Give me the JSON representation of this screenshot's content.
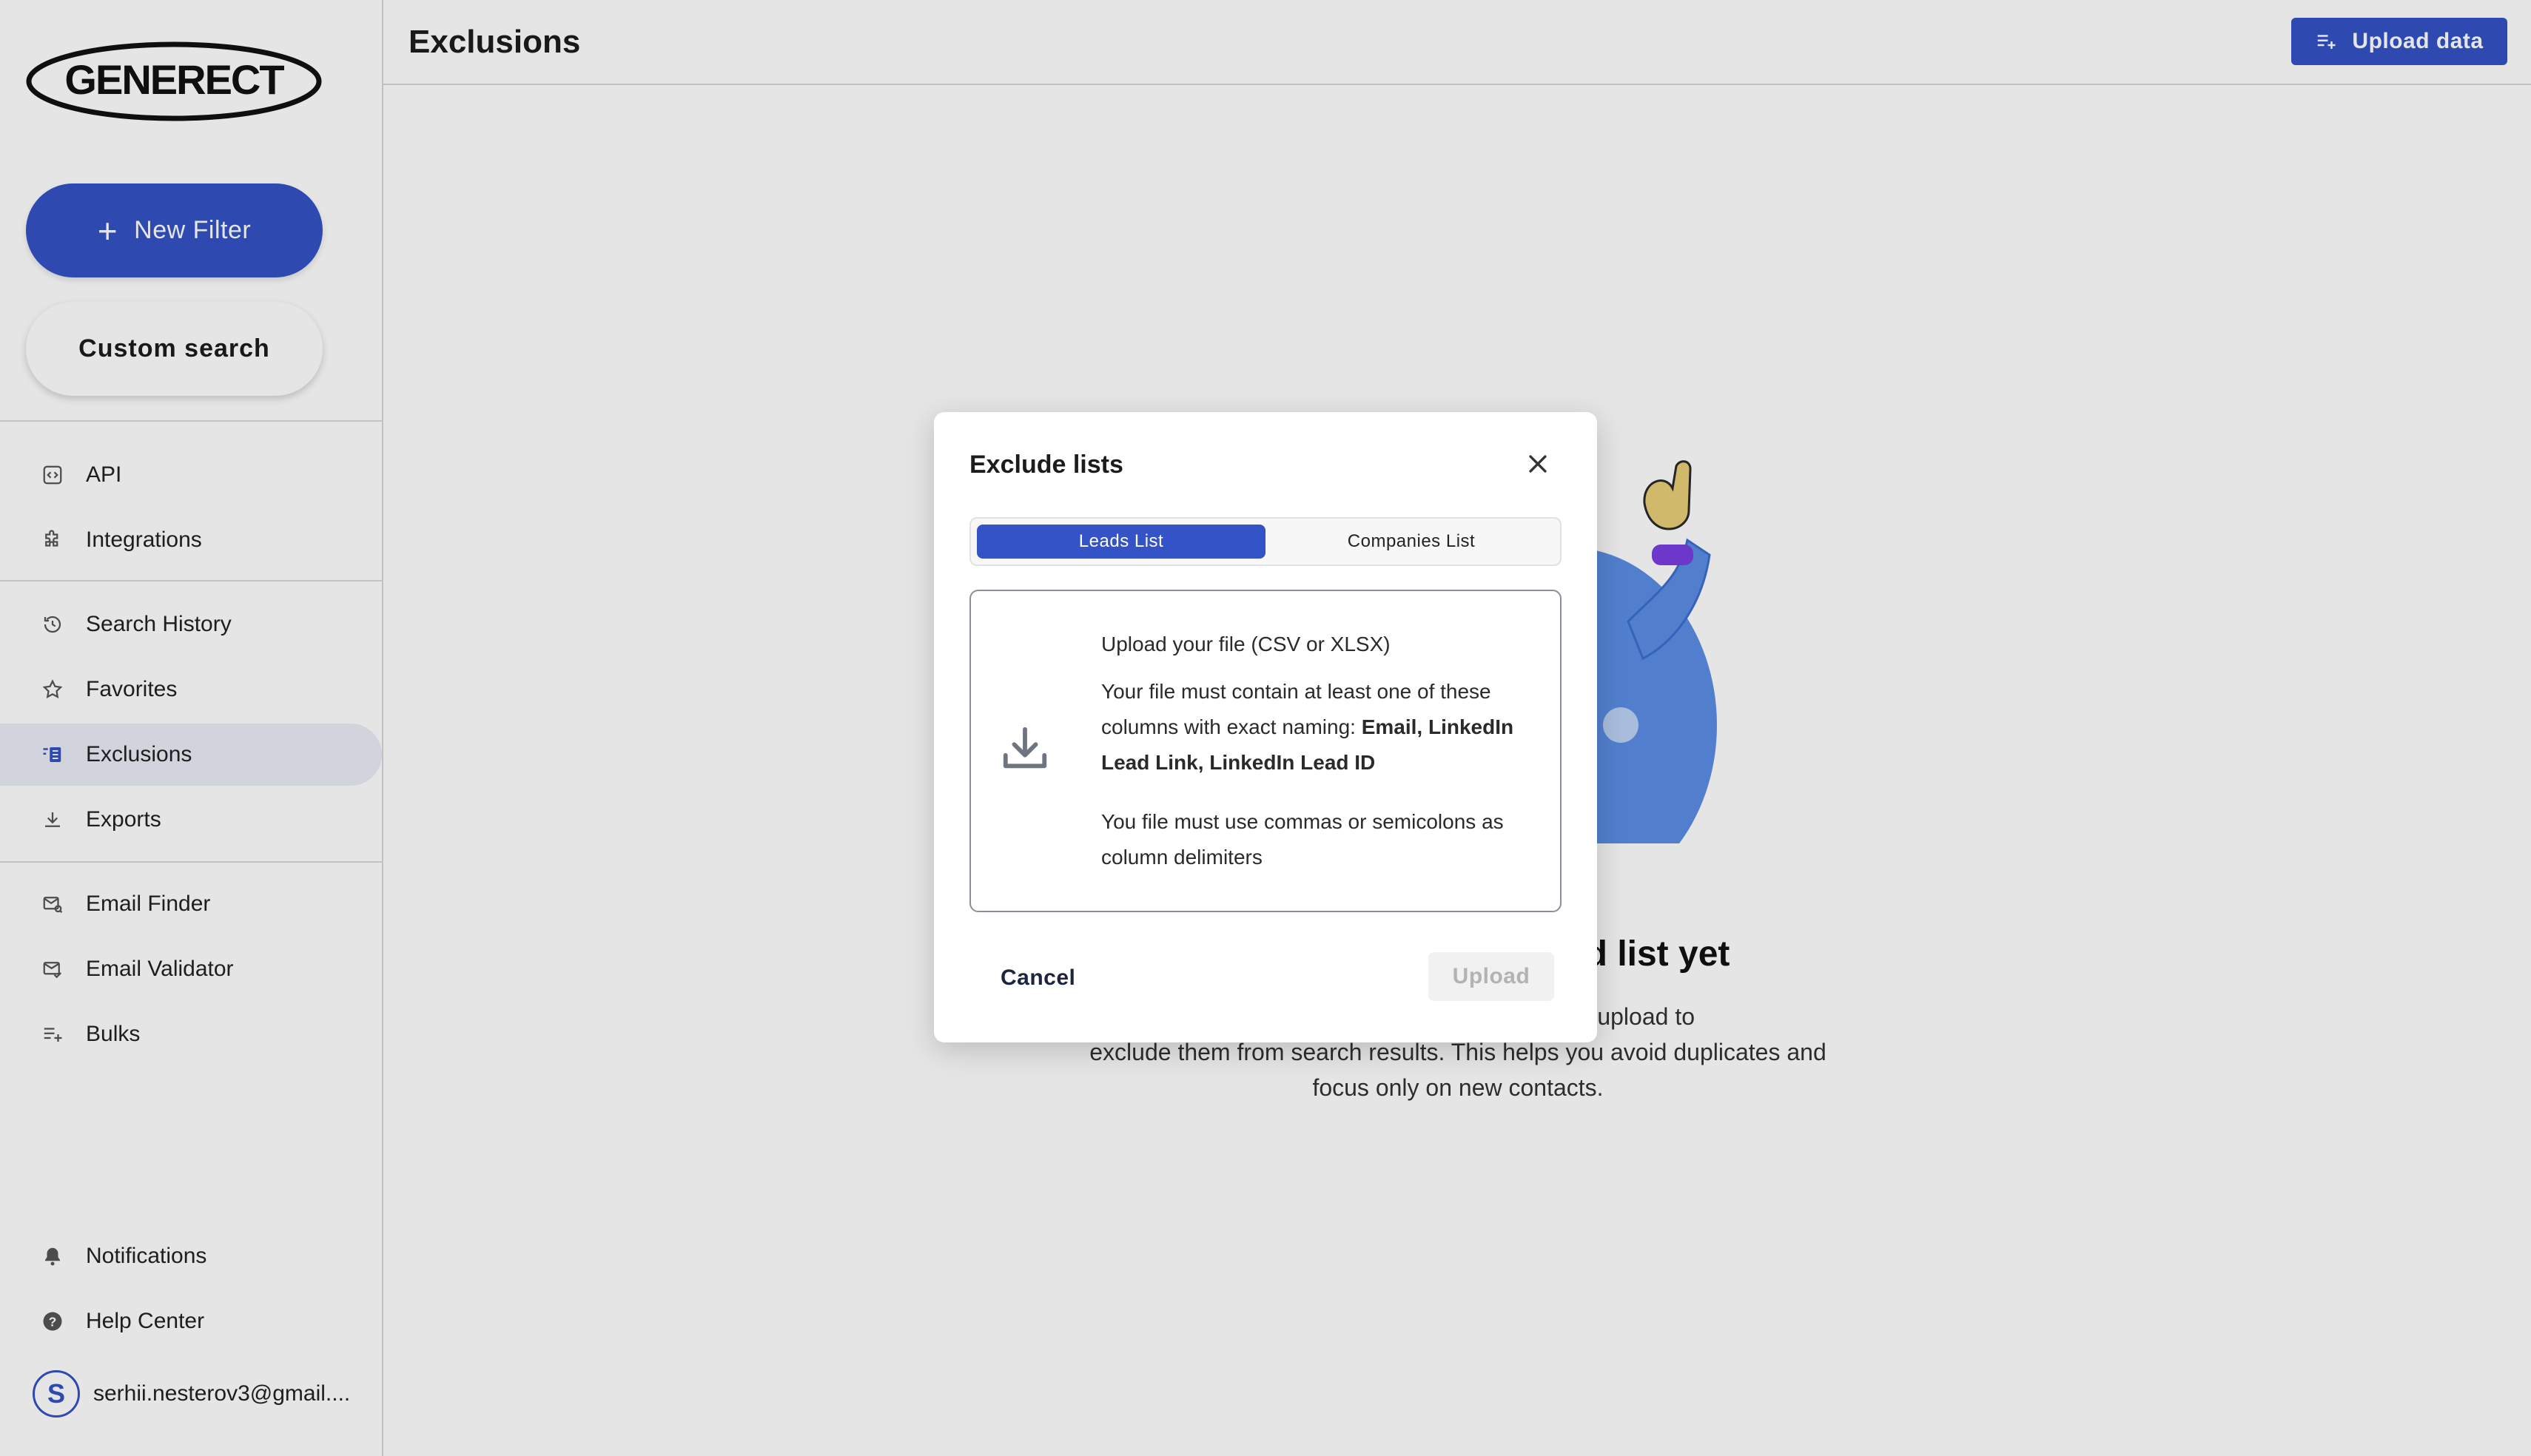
{
  "sidebar": {
    "logo_text": "GENERECT",
    "new_filter_label": "New Filter",
    "custom_search_label": "Custom search",
    "items": [
      {
        "label": "API",
        "icon": "api-icon"
      },
      {
        "label": "Integrations",
        "icon": "puzzle-icon"
      },
      {
        "label": "Search History",
        "icon": "history-icon"
      },
      {
        "label": "Favorites",
        "icon": "star-icon"
      },
      {
        "label": "Exclusions",
        "icon": "exclusions-icon",
        "active": true
      },
      {
        "label": "Exports",
        "icon": "download-icon"
      },
      {
        "label": "Email Finder",
        "icon": "email-search-icon"
      },
      {
        "label": "Email Validator",
        "icon": "email-check-icon"
      },
      {
        "label": "Bulks",
        "icon": "playlist-add-icon"
      },
      {
        "label": "Notifications",
        "icon": "bell-icon"
      },
      {
        "label": "Help Center",
        "icon": "help-icon"
      }
    ],
    "user": {
      "initial": "S",
      "email": "serhii.nesterov3@gmail...."
    }
  },
  "header": {
    "title": "Exclusions",
    "upload_label": "Upload data"
  },
  "empty_state": {
    "title_visible": "led list yet",
    "text_line1_visible": "s that you upload to",
    "text_line2": "exclude them from search results. This helps you avoid duplicates and",
    "text_line3": "focus only on new contacts."
  },
  "modal": {
    "title": "Exclude lists",
    "tabs": [
      "Leads List",
      "Companies List"
    ],
    "active_tab": "Leads List",
    "upload_title": "Upload your file (CSV or XLSX)",
    "requirement_prefix": "Your file must contain at least one of these columns with exact naming: ",
    "requirement_columns": "Email, LinkedIn Lead Link, LinkedIn Lead ID",
    "delimiter_note": "You file must use commas or semicolons as column delimiters",
    "cancel_label": "Cancel",
    "upload_label": "Upload"
  },
  "colors": {
    "accent": "#3453c6",
    "active_nav_bg": "#eaecf6",
    "disabled_bg": "#f1f1f1"
  }
}
